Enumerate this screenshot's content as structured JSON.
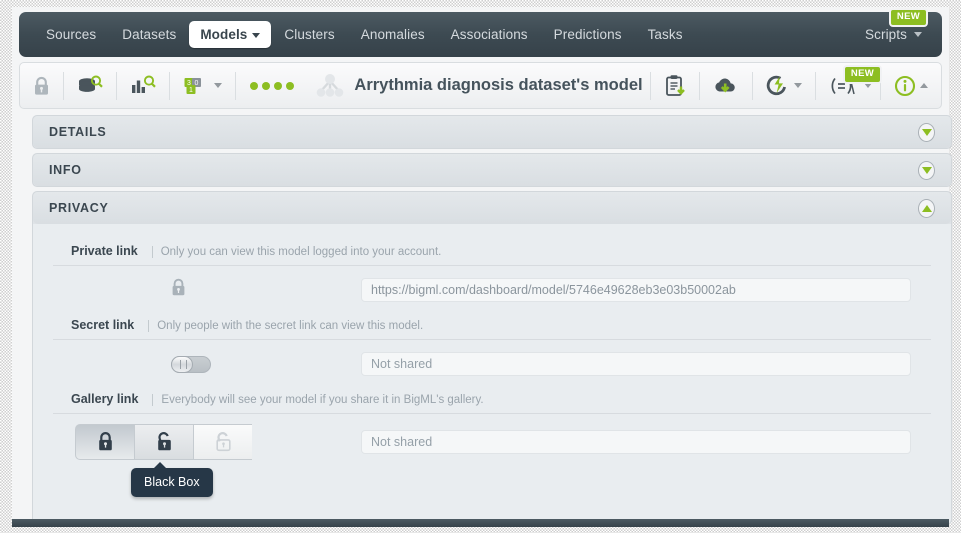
{
  "nav": {
    "items": [
      {
        "label": "Sources",
        "active": false,
        "dropdown": false
      },
      {
        "label": "Datasets",
        "active": false,
        "dropdown": false
      },
      {
        "label": "Models",
        "active": true,
        "dropdown": true
      },
      {
        "label": "Clusters",
        "active": false,
        "dropdown": false
      },
      {
        "label": "Anomalies",
        "active": false,
        "dropdown": false
      },
      {
        "label": "Associations",
        "active": false,
        "dropdown": false
      },
      {
        "label": "Predictions",
        "active": false,
        "dropdown": false
      },
      {
        "label": "Tasks",
        "active": false,
        "dropdown": false
      }
    ],
    "right": {
      "label": "Scripts",
      "badge": "NEW"
    }
  },
  "toolbar": {
    "title": "Arrythmia diagnosis dataset's model",
    "left_icons": [
      "lock-icon",
      "dataset-search-icon",
      "histogram-search-icon",
      "node-threshold-icon"
    ],
    "node_icon_numbers": {
      "top_left": "3",
      "top_right": "0",
      "bottom": "1"
    },
    "dots_count": 4,
    "right_icons": [
      "clipboard-download-icon",
      "cloud-download-icon",
      "flash-icon",
      "formula-icon",
      "info-icon"
    ],
    "formula_badge": "NEW"
  },
  "sections": [
    {
      "title": "DETAILS",
      "expanded": false
    },
    {
      "title": "INFO",
      "expanded": false
    },
    {
      "title": "PRIVACY",
      "expanded": true
    }
  ],
  "privacy": {
    "rows": [
      {
        "label": "Private link",
        "description": "Only you can view this model logged into your account.",
        "control": "lock",
        "value": "https://bigml.com/dashboard/model/5746e49628eb3e03b50002ab"
      },
      {
        "label": "Secret link",
        "description": "Only people with the secret link can view this model.",
        "control": "switch",
        "switch_state": "off",
        "value": "Not shared"
      },
      {
        "label": "Gallery link",
        "description": "Everybody will see your model if you share it in BigML's gallery.",
        "control": "lock-group",
        "value": "Not shared",
        "buttons": [
          {
            "name": "closed-lock",
            "state": "selected"
          },
          {
            "name": "open-lock",
            "state": "hovered"
          },
          {
            "name": "unlocked-lock",
            "state": "disabled"
          }
        ],
        "tooltip": "Black Box"
      }
    ]
  },
  "colors": {
    "nav_bg": "#3d4a52",
    "accent_green": "#8dbe22",
    "panel_bg": "#e9edf0",
    "header_bg": "#dfe3e7",
    "tooltip_bg": "#263747",
    "text_dark": "#3b4750",
    "text_muted": "#9aa4ac"
  }
}
